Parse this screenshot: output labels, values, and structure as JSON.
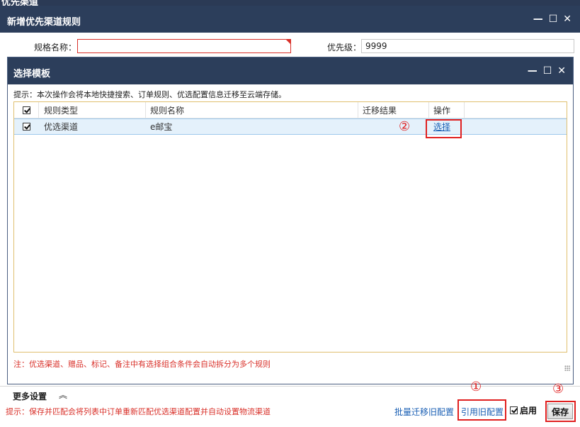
{
  "top_strip": {
    "text": "优先渠道"
  },
  "outer_dialog": {
    "title": "新增优先渠道规则"
  },
  "form": {
    "spec_name_label": "规格名称：",
    "spec_name_value": "",
    "priority_label": "优先级：",
    "priority_value": "9999"
  },
  "inner_dialog": {
    "title": "选择模板",
    "hint": "提示：本次操作会将本地快捷搜索、订单规则、优选配置信息迁移至云端存储。",
    "columns": [
      "规则类型",
      "规则名称",
      "迁移结果",
      "操作"
    ],
    "rows": [
      {
        "type": "优选渠道",
        "name": "e邮宝",
        "result": "",
        "action": "选择"
      }
    ],
    "note": "注：优选渠道、赠品、标记、备注中有选择组合条件会自动拆分为多个规则"
  },
  "annotations": {
    "circle_1": "①",
    "circle_2": "②",
    "circle_3": "③"
  },
  "more_settings": {
    "label": "更多设置",
    "chevron": "︽"
  },
  "footer": {
    "hint": "提示：保存并匹配会将列表中订单重新匹配优选渠道配置并自动设置物流渠道",
    "batch_migrate": "批量迁移旧配置",
    "cite_old": "引用旧配置",
    "enable_label": "启用",
    "save_label": "保存"
  },
  "window_controls": {
    "minimize": "—",
    "maximize": "☐",
    "close": "✕"
  },
  "colors": {
    "title_bar": "#2c3e5b",
    "link": "#1a5fb4",
    "warning": "#d9312a",
    "highlight_row": "#e4f1fb"
  }
}
